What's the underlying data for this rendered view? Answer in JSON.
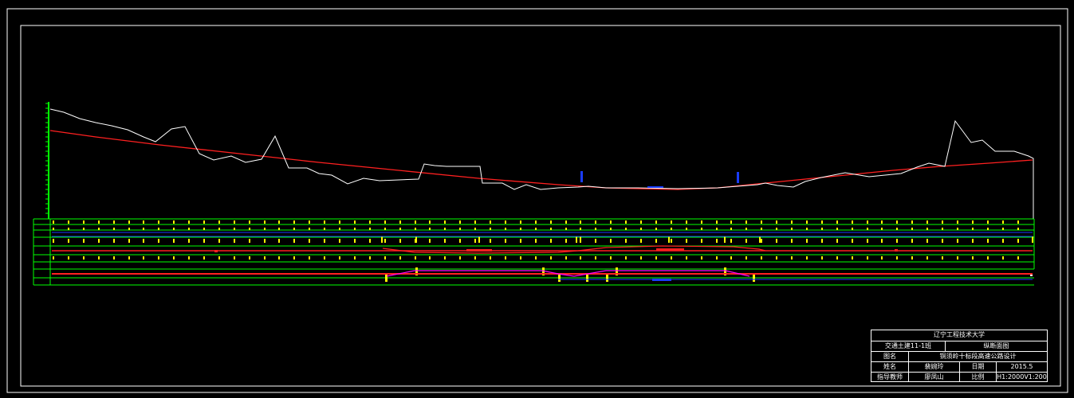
{
  "colors": {
    "background": "#000000",
    "frame": "#ffffff",
    "ground_line": "#ffffff",
    "design_line": "#ff2020",
    "grid": "#00ff00",
    "ticks": "#ffff00",
    "structures": "#1a3cff",
    "magenta": "#ff00ff"
  },
  "title_block": {
    "university": "辽宁工程技术大学",
    "class": "交通土建11-1班",
    "drawing": "纵断面图",
    "drawing_name_label": "图名",
    "project": "铜须岭十标段高速公路设计",
    "name_label": "姓名",
    "author": "裴婉玲",
    "date_label": "日期",
    "date": "2015.5",
    "advisor_label": "指导教师",
    "advisor": "廖凤山",
    "scale_label": "比例",
    "scale": "H1:2000V1:200"
  },
  "profile": {
    "ground_line_label": "ground-line",
    "design_line_label": "design-grade-line"
  }
}
